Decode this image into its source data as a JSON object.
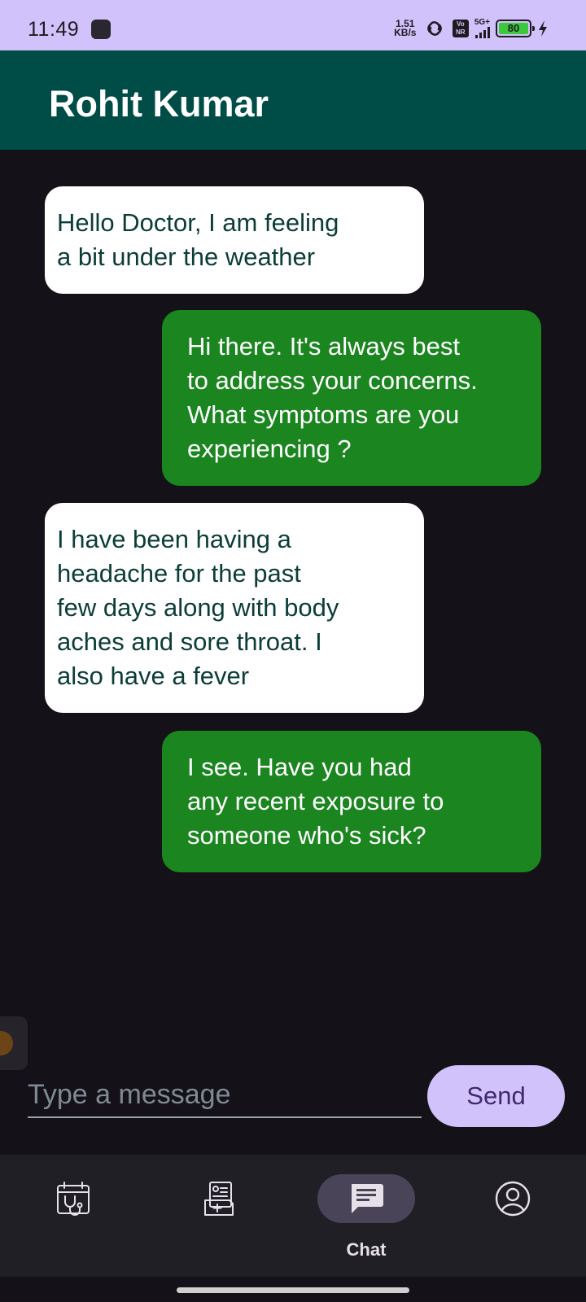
{
  "status_bar": {
    "time": "11:49",
    "net_speed_value": "1.51",
    "net_speed_unit": "KB/s",
    "volte": "Vo NR",
    "network": "5G+",
    "battery": "80",
    "colors": {
      "background": "#d1c2fb",
      "battery_fill": "#3cc83c"
    }
  },
  "header": {
    "title": "Rohit Kumar",
    "color": "#004d47"
  },
  "messages": [
    {
      "sender": "patient",
      "text": "Hello Doctor, I am feeling\na bit under the weather"
    },
    {
      "sender": "doctor",
      "text": "Hi there. It's always best\nto address your concerns.\nWhat symptoms are you\nexperiencing ?"
    },
    {
      "sender": "patient",
      "text": "I have been having a\nheadache for the past\nfew days along with body\naches and sore throat. I\nalso have a fever"
    },
    {
      "sender": "doctor",
      "text": "I see. Have you had\nany recent exposure to\nsomeone who's sick?"
    }
  ],
  "composer": {
    "placeholder": "Type a message",
    "send_label": "Send",
    "send_color": "#d1c2fb"
  },
  "bottom_nav": {
    "items": [
      {
        "icon": "calendar-stethoscope-icon",
        "label": ""
      },
      {
        "icon": "medical-records-icon",
        "label": ""
      },
      {
        "icon": "chat-icon",
        "label": "Chat",
        "active": true
      },
      {
        "icon": "profile-icon",
        "label": ""
      }
    ]
  }
}
